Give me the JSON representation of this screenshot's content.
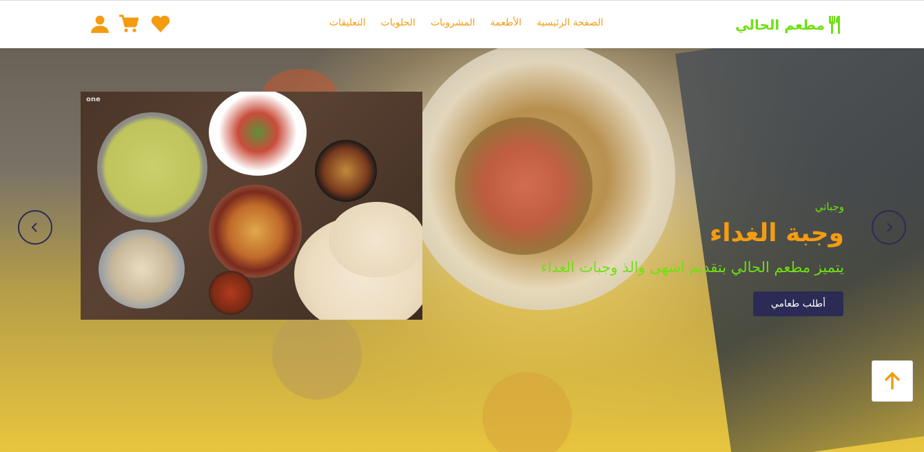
{
  "brand": {
    "name": "مطعم الحالي",
    "icon": "utensils-icon",
    "color": "#6fe012"
  },
  "nav": {
    "links": [
      "الصفحة الرئيسية",
      "الأطعمة",
      "المشروبات",
      "الحلويات",
      "التعليقات"
    ],
    "link_color": "#f39c12",
    "icons": [
      "heart-icon",
      "cart-icon",
      "user-icon"
    ]
  },
  "hero": {
    "subtitle": "وجباتي",
    "title": "وجبة الغداء",
    "description": "يتميز مطعم الحالي بتقديم اشهى والذ وجبات الغداء",
    "order_button": "أطلب طعامي",
    "photo_watermark": "one",
    "button_color": "#2b2b55",
    "title_color": "#f39c12",
    "accent_color": "#6fe012"
  },
  "controls": {
    "prev_icon": "chevron-left-icon",
    "next_icon": "chevron-right-icon",
    "scroll_top_icon": "arrow-up-icon"
  }
}
